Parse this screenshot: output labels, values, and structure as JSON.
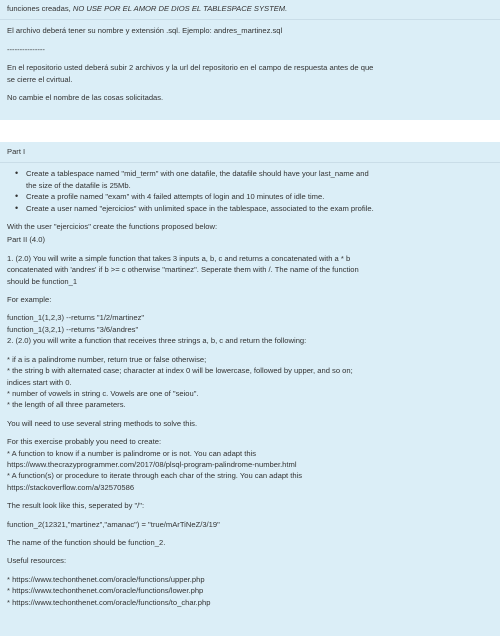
{
  "panel1": {
    "line1_plain": "funciones creadas, ",
    "line1_italic": "NO USE POR EL AMOR DE DIOS EL TABLESPACE SYSTEM.",
    "line2": "El archivo deberá tener su nombre y extensión .sql. Ejemplo: andres_martinez.sql",
    "line3": "---------------",
    "line4": "En el repositorio usted deberá subir 2 archivos y la url del repositorio en el campo de respuesta antes de que",
    "line5": "se cierre el cvirtual.",
    "line6": "No cambie el nombre de las cosas solicitadas."
  },
  "panel2": {
    "part1": "Part I",
    "bullets": [
      "Create a tablespace named \"mid_term\" with one datafile, the datafile should have your last_name and",
      "the size of the datafile is 25Mb.",
      "Create a profile named \"exam\" with 4 failed attempts of login and 10 minutes of idle time.",
      "Create a user named \"ejercicios\" with unlimited space in the tablespace, associated to the exam profile."
    ],
    "with_user": "With the user \"ejercicios\" create the functions proposed below:",
    "part2": "Part II (4.0)",
    "q1_a": "1. (2.0) You will write a simple function that takes 3 inputs a, b, c and returns a concatenated with a * b",
    "q1_b": "concatenated with 'andres' if b >= c otherwise \"martinez\". Seperate them with /. The name of the function",
    "q1_c": "should be function_1",
    "for_example": "For example:",
    "ex1": "function_1(1,2,3) --returns \"1/2/martinez\"",
    "ex2": "function_1(3,2,1) --returns \"3/6/andres\"",
    "q2": "2. (2.0) you will write a function that receives three strings a, b, c and return the following:",
    "q2_l1": "* if a is a palindrome number, return true or false otherwise;",
    "q2_l2": "* the string b with alternated case; character at index 0 will be lowercase, followed by upper, and so on;",
    "q2_l3": "indices start with 0.",
    "q2_l4": "* number of vowels in string c. Vowels are one of \"seiou\".",
    "q2_l5": "* the length of all three parameters.",
    "string_methods": "You will need to use several string methods to solve this.",
    "exercise_intro": "For this exercise probably you need to create:",
    "ex_l1": "* A function to know if a number is palindrome or is not. You can adapt this",
    "ex_l2": "https://www.thecrazyprogrammer.com/2017/08/plsql-program-palindrome-number.html",
    "ex_l3": "* A function(s) or procedure to iterate through each char of the string. You can adapt this",
    "ex_l4": "https://stackoverflow.com/a/32570586",
    "result_intro": "The result look like this, seperated by \"/\":",
    "result_example": "function_2(12321,\"martinez\",\"amanac\") = \"true/mArTiNeZ/3/19\"",
    "name_f2": "The name of the function should be function_2.",
    "useful": "Useful resources:",
    "res1": "* https://www.techonthenet.com/oracle/functions/upper.php",
    "res2": "* https://www.techonthenet.com/oracle/functions/lower.php",
    "res3": "* https://www.techonthenet.com/oracle/functions/to_char.php"
  }
}
